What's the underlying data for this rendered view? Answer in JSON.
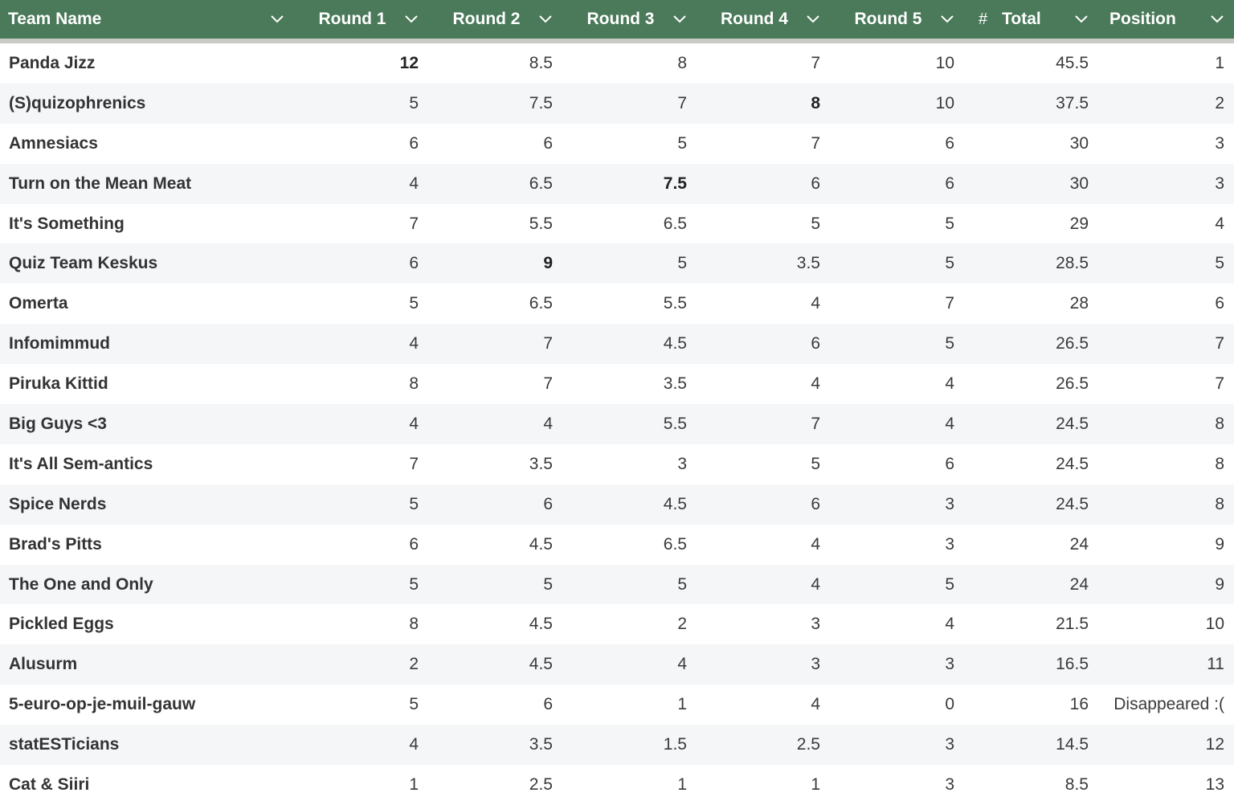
{
  "columns": [
    {
      "label": "Team Name"
    },
    {
      "label": "Round 1"
    },
    {
      "label": "Round 2"
    },
    {
      "label": "Round 3"
    },
    {
      "label": "Round 4"
    },
    {
      "label": "Round 5"
    },
    {
      "label": "Total",
      "prefix": "#"
    },
    {
      "label": "Position"
    }
  ],
  "rows": [
    {
      "team": "Panda Jizz",
      "r": [
        "12",
        "8.5",
        "8",
        "7",
        "10"
      ],
      "total": "45.5",
      "position": "1",
      "bold": [
        0
      ]
    },
    {
      "team": "(S)quizophrenics",
      "r": [
        "5",
        "7.5",
        "7",
        "8",
        "10"
      ],
      "total": "37.5",
      "position": "2",
      "bold": [
        3
      ]
    },
    {
      "team": "Amnesiacs",
      "r": [
        "6",
        "6",
        "5",
        "7",
        "6"
      ],
      "total": "30",
      "position": "3",
      "bold": []
    },
    {
      "team": "Turn on the Mean Meat",
      "r": [
        "4",
        "6.5",
        "7.5",
        "6",
        "6"
      ],
      "total": "30",
      "position": "3",
      "bold": [
        2
      ]
    },
    {
      "team": "It's Something",
      "r": [
        "7",
        "5.5",
        "6.5",
        "5",
        "5"
      ],
      "total": "29",
      "position": "4",
      "bold": []
    },
    {
      "team": "Quiz Team Keskus",
      "r": [
        "6",
        "9",
        "5",
        "3.5",
        "5"
      ],
      "total": "28.5",
      "position": "5",
      "bold": [
        1
      ]
    },
    {
      "team": "Omerta",
      "r": [
        "5",
        "6.5",
        "5.5",
        "4",
        "7"
      ],
      "total": "28",
      "position": "6",
      "bold": []
    },
    {
      "team": "Infomimmud",
      "r": [
        "4",
        "7",
        "4.5",
        "6",
        "5"
      ],
      "total": "26.5",
      "position": "7",
      "bold": []
    },
    {
      "team": "Piruka Kittid",
      "r": [
        "8",
        "7",
        "3.5",
        "4",
        "4"
      ],
      "total": "26.5",
      "position": "7",
      "bold": []
    },
    {
      "team": "Big Guys <3",
      "r": [
        "4",
        "4",
        "5.5",
        "7",
        "4"
      ],
      "total": "24.5",
      "position": "8",
      "bold": []
    },
    {
      "team": "It's All Sem-antics",
      "r": [
        "7",
        "3.5",
        "3",
        "5",
        "6"
      ],
      "total": "24.5",
      "position": "8",
      "bold": []
    },
    {
      "team": "Spice Nerds",
      "r": [
        "5",
        "6",
        "4.5",
        "6",
        "3"
      ],
      "total": "24.5",
      "position": "8",
      "bold": []
    },
    {
      "team": "Brad's Pitts",
      "r": [
        "6",
        "4.5",
        "6.5",
        "4",
        "3"
      ],
      "total": "24",
      "position": "9",
      "bold": []
    },
    {
      "team": "The One and Only",
      "r": [
        "5",
        "5",
        "5",
        "4",
        "5"
      ],
      "total": "24",
      "position": "9",
      "bold": []
    },
    {
      "team": "Pickled Eggs",
      "r": [
        "8",
        "4.5",
        "2",
        "3",
        "4"
      ],
      "total": "21.5",
      "position": "10",
      "bold": []
    },
    {
      "team": "Alusurm",
      "r": [
        "2",
        "4.5",
        "4",
        "3",
        "3"
      ],
      "total": "16.5",
      "position": "11",
      "bold": []
    },
    {
      "team": "5-euro-op-je-muil-gauw",
      "r": [
        "5",
        "6",
        "1",
        "4",
        "0"
      ],
      "total": "16",
      "position": "Disappeared :(",
      "bold": []
    },
    {
      "team": "statESTicians",
      "r": [
        "4",
        "3.5",
        "1.5",
        "2.5",
        "3"
      ],
      "total": "14.5",
      "position": "12",
      "bold": []
    },
    {
      "team": "Cat & Siiri",
      "r": [
        "1",
        "2.5",
        "1",
        "1",
        "3"
      ],
      "total": "8.5",
      "position": "13",
      "bold": []
    }
  ]
}
